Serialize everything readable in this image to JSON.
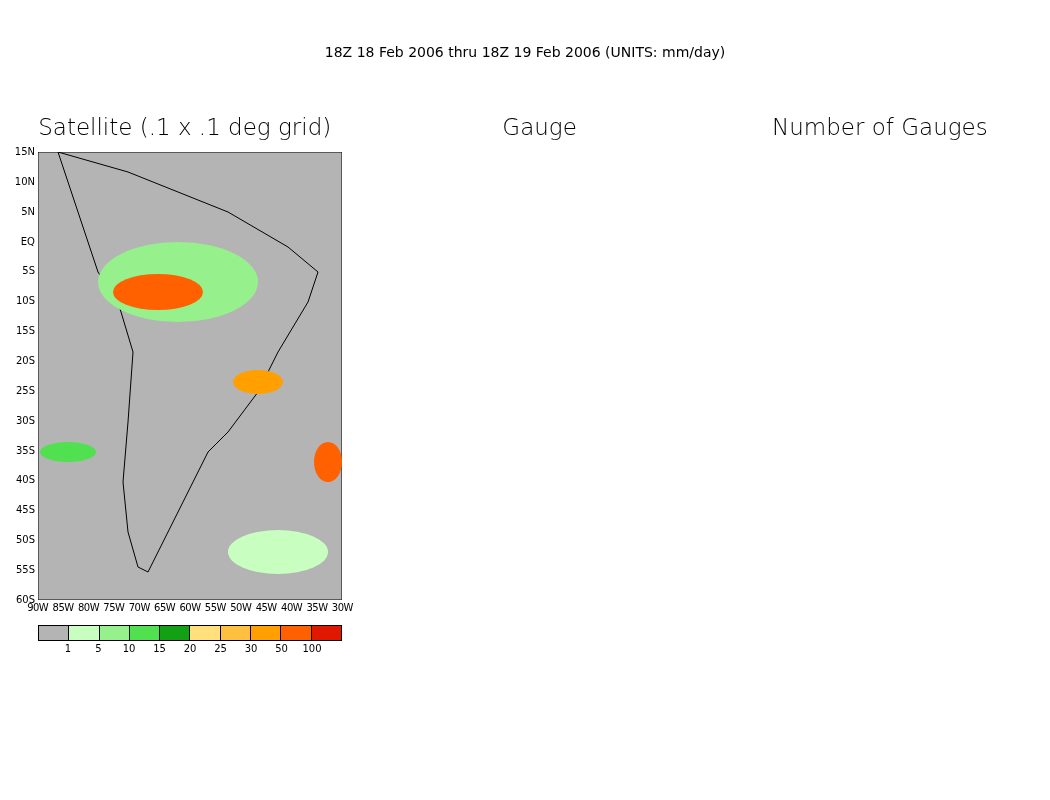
{
  "header": "18Z 18 Feb 2006 thru 18Z 19 Feb 2006 (UNITS: mm/day)",
  "panels": [
    {
      "title": "Satellite (.1 x .1 deg grid)"
    },
    {
      "title": "Gauge"
    },
    {
      "title": "Number of Gauges"
    }
  ],
  "map": {
    "lat_labels": [
      "15N",
      "10N",
      "5N",
      "EQ",
      "5S",
      "10S",
      "15S",
      "20S",
      "25S",
      "30S",
      "35S",
      "40S",
      "45S",
      "50S",
      "55S",
      "60S"
    ],
    "lon_labels": [
      "90W",
      "85W",
      "80W",
      "75W",
      "70W",
      "65W",
      "60W",
      "55W",
      "50W",
      "45W",
      "40W",
      "35W",
      "30W"
    ]
  },
  "legend": {
    "colors": [
      {
        "color": "#b4b4b4"
      },
      {
        "color": "#c8ffc0"
      },
      {
        "color": "#96f08c"
      },
      {
        "color": "#50e050"
      },
      {
        "color": "#14a014"
      },
      {
        "color": "#ffe07c"
      },
      {
        "color": "#ffc040"
      },
      {
        "color": "#ffa000"
      },
      {
        "color": "#ff6000"
      },
      {
        "color": "#e01800"
      }
    ],
    "labels": [
      "1",
      "5",
      "10",
      "15",
      "20",
      "25",
      "30",
      "50",
      "100"
    ]
  }
}
